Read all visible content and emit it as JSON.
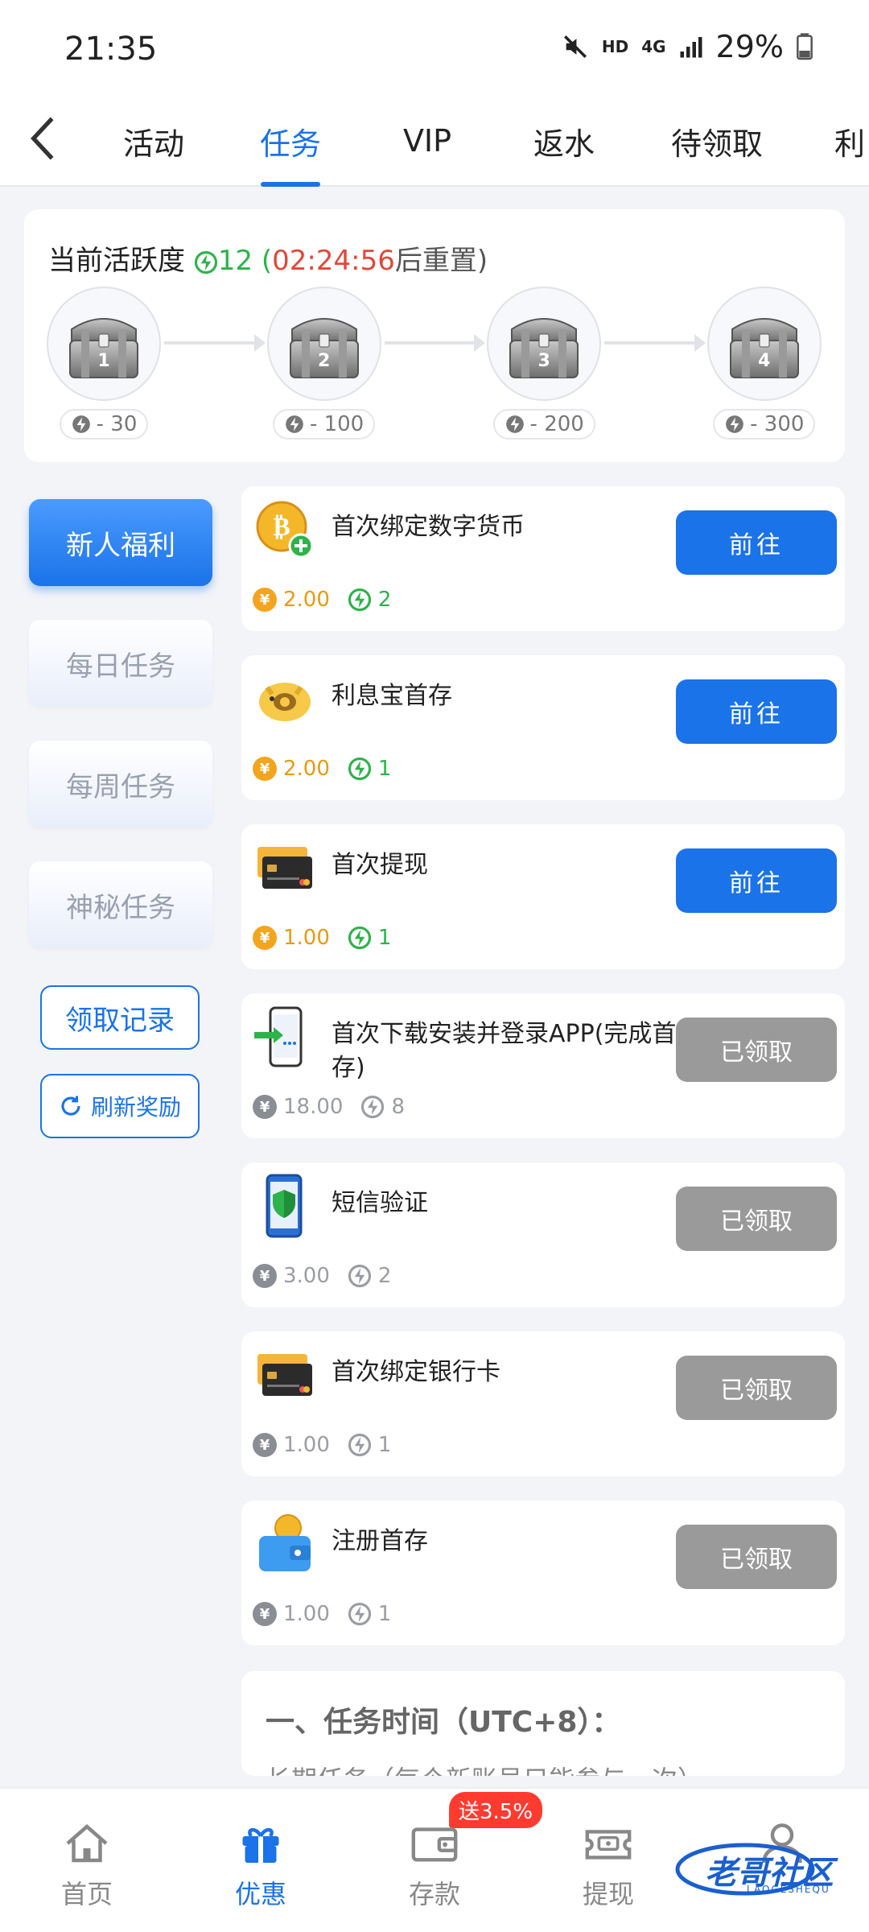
{
  "status_bar": {
    "time": "21:35",
    "hd": "HD",
    "net": "4G",
    "battery": "29%"
  },
  "tabs": [
    {
      "label": "活动",
      "active": false
    },
    {
      "label": "任务",
      "active": true
    },
    {
      "label": "VIP",
      "active": false
    },
    {
      "label": "返水",
      "active": false
    },
    {
      "label": "待领取",
      "active": false
    },
    {
      "label": "利",
      "active": false
    }
  ],
  "activity": {
    "label": "当前活跃度",
    "value": "12",
    "paren_open": "(",
    "countdown": "02:24:56",
    "reset_text": "后重置)",
    "chests": [
      {
        "num": "1",
        "req": "- 30"
      },
      {
        "num": "2",
        "req": "- 100"
      },
      {
        "num": "3",
        "req": "- 200"
      },
      {
        "num": "4",
        "req": "- 300"
      }
    ]
  },
  "side_menu": [
    {
      "label": "新人福利",
      "active": true
    },
    {
      "label": "每日任务",
      "active": false
    },
    {
      "label": "每周任务",
      "active": false
    },
    {
      "label": "神秘任务",
      "active": false
    }
  ],
  "side_actions": {
    "records": "领取记录",
    "refresh": "刷新奖励"
  },
  "tasks": [
    {
      "name": "首次绑定数字货币",
      "amount": "2.00",
      "activity": "2",
      "button": "前往",
      "status": "go",
      "icon": "bitcoin-add-icon"
    },
    {
      "name": "利息宝首存",
      "amount": "2.00",
      "activity": "1",
      "button": "前往",
      "status": "go",
      "icon": "piggy-bank-icon"
    },
    {
      "name": "首次提现",
      "amount": "1.00",
      "activity": "1",
      "button": "前往",
      "status": "go",
      "icon": "bank-cards-icon"
    },
    {
      "name": "首次下载安装并登录APP(完成首存)",
      "amount": "18.00",
      "activity": "8",
      "button": "已领取",
      "status": "done",
      "icon": "phone-download-icon"
    },
    {
      "name": "短信验证",
      "amount": "3.00",
      "activity": "2",
      "button": "已领取",
      "status": "done",
      "icon": "phone-shield-icon"
    },
    {
      "name": "首次绑定银行卡",
      "amount": "1.00",
      "activity": "1",
      "button": "已领取",
      "status": "done",
      "icon": "bank-cards-icon"
    },
    {
      "name": "注册首存",
      "amount": "1.00",
      "activity": "1",
      "button": "已领取",
      "status": "done",
      "icon": "wallet-coin-icon"
    }
  ],
  "currency_symbol": "¥",
  "rules": {
    "heading": "一、任务时间（UTC+8）：",
    "line": "长期任务（每个新账号只能参与一次）"
  },
  "bottom_nav": [
    {
      "label": "首页",
      "icon": "home-icon",
      "active": false
    },
    {
      "label": "优惠",
      "icon": "gift-icon",
      "active": true
    },
    {
      "label": "存款",
      "icon": "wallet-icon",
      "active": false
    },
    {
      "label": "提现",
      "icon": "ticket-icon",
      "active": false
    },
    {
      "label": "我的",
      "icon": "user-icon",
      "active": false
    }
  ],
  "deposit_badge": "送3.5%",
  "watermark": {
    "text": "老哥社区",
    "sub": "LAOGESHEQU"
  },
  "colors": {
    "accent": "#1a73e8",
    "activity_green": "#2db34a",
    "countdown_red": "#e0483a",
    "reward_orange": "#e89b12",
    "claimed_gray": "#9a9a9a"
  }
}
